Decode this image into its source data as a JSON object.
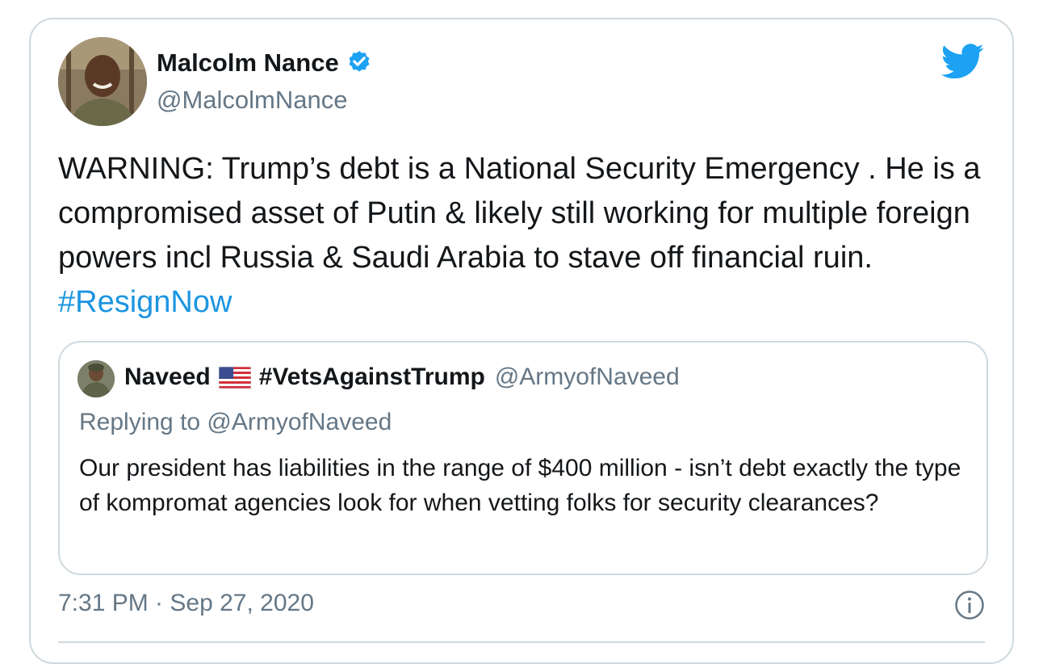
{
  "tweet": {
    "author": {
      "name": "Malcolm Nance",
      "handle": "@MalcolmNance",
      "verified": true
    },
    "text": "WARNING: Trump’s debt is a National Security Emergency . He is a compromised asset of Putin & likely still working for multiple foreign powers incl Russia & Saudi Arabia to stave off financial ruin.  ",
    "hashtag": "#ResignNow",
    "timestamp": "7:31 PM · Sep 27, 2020",
    "icons": {
      "brand": "twitter-bird-icon",
      "verified": "verified-badge-icon",
      "info": "info-icon"
    },
    "colors": {
      "accent": "#1b95e0",
      "muted": "#657786",
      "border": "#cfd9de"
    }
  },
  "quote": {
    "name": "Naveed",
    "hashtag_name": "#VetsAgainstTrump",
    "handle": "@ArmyofNaveed",
    "flag": "us-flag-icon",
    "replying_to": "Replying to @ArmyofNaveed",
    "text": "Our president has liabilities in the range of $400 million - isn’t debt exactly the type of kompromat agencies look for when vetting folks for security clearances?"
  }
}
